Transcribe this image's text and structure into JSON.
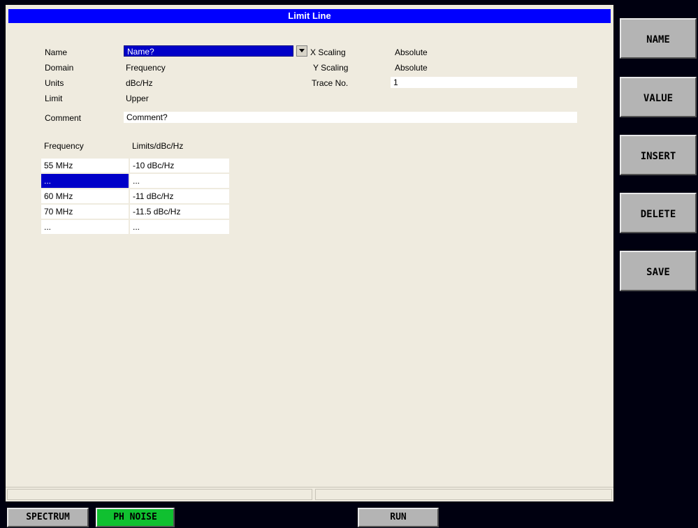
{
  "dialog": {
    "title": "Limit Line",
    "labels": {
      "name": "Name",
      "domain": "Domain",
      "units": "Units",
      "limit": "Limit",
      "comment": "Comment",
      "x_scaling": "X Scaling",
      "y_scaling": "Y Scaling",
      "trace_no": "Trace No."
    },
    "values": {
      "name": "Name?",
      "domain": "Frequency",
      "units": "dBc/Hz",
      "limit": "Upper",
      "comment": "Comment?",
      "x_scaling": "Absolute",
      "y_scaling": "Absolute",
      "trace_no": "1"
    },
    "table": {
      "headers": [
        "Frequency",
        "Limits/dBc/Hz"
      ],
      "rows": [
        {
          "frequency": "55 MHz",
          "limit": "-10 dBc/Hz"
        },
        {
          "frequency": "...",
          "limit": "..."
        },
        {
          "frequency": "60 MHz",
          "limit": "-11 dBc/Hz"
        },
        {
          "frequency": "70 MHz",
          "limit": "-11.5 dBc/Hz"
        },
        {
          "frequency": "...",
          "limit": "..."
        }
      ]
    }
  },
  "softkeys": [
    "NAME",
    "VALUE",
    "INSERT",
    "DELETE",
    "SAVE"
  ],
  "hotkeys": [
    "SPECTRUM",
    "PH NOISE",
    "RUN"
  ],
  "colors": {
    "title_bar": "#0000ff",
    "selection": "#0000c8",
    "panel": "#efebdf",
    "active_hotkey": "#10c030",
    "screen_background": "#000010"
  }
}
